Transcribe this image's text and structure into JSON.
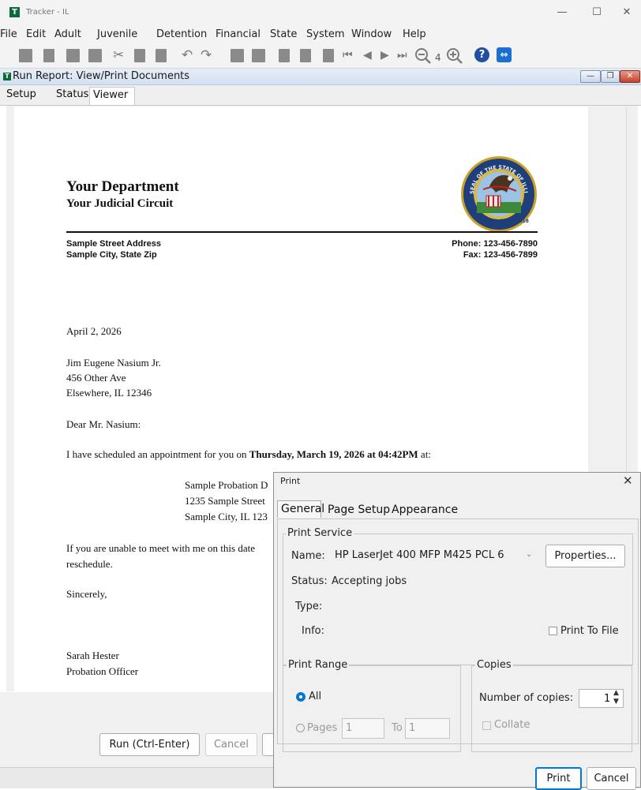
{
  "window": {
    "title": "Tracker - IL",
    "icon_letter": "T",
    "minimize": "—",
    "maximize": "☐",
    "close": "✕"
  },
  "menubar": [
    "File",
    "Edit",
    "Adult",
    "Juvenile",
    "Detention",
    "Financial",
    "State",
    "System",
    "Window",
    "Help"
  ],
  "toolbar": {
    "zoom_level": "4"
  },
  "inner_window": {
    "title": "Run Report: View/Print Documents",
    "icon_letter": "T",
    "minimize": "—",
    "restore": "❐",
    "close": "✕"
  },
  "tabs": [
    "Setup",
    "Status",
    "Viewer"
  ],
  "letter": {
    "dept_name": "Your Department",
    "circuit": "Your Judicial Circuit",
    "address_line1": "Sample Street Address",
    "address_line2": "Sample City, State Zip",
    "phone": "Phone: 123-456-7890",
    "fax": "Fax: 123-456-7899",
    "date": "April 2, 2026",
    "recipient_name": "Jim Eugene Nasium Jr.",
    "recipient_street": "456 Other Ave",
    "recipient_city": "Elsewhere, IL 12346",
    "salutation": "Dear Mr. Nasium:",
    "body_prefix": "I have scheduled an appointment for you on ",
    "body_bold": "Thursday, March 19, 2026 at 04:42PM",
    "body_suffix": " at:",
    "location_line1": "Sample Probation D",
    "location_line2": "1235 Sample Street",
    "location_line3": "Sample City, IL 123",
    "unable_line1": "If you are unable to meet with me on this date",
    "unable_line2": "reschedule.",
    "closing": "Sincerely,",
    "signer_name": "Sarah Hester",
    "signer_title": "Probation Officer",
    "seal_ring_text": "SEAL OF THE STATE OF ILLINOIS",
    "seal_date_text": "AUG. 26TH 1818"
  },
  "buttons": {
    "run": "Run (Ctrl-Enter)",
    "cancel": "Cancel"
  },
  "print_dialog": {
    "title": "Print",
    "close": "✕",
    "tabs": [
      "General",
      "Page Setup",
      "Appearance"
    ],
    "print_service_legend": "Print Service",
    "name_label": "Name:",
    "printer_name": "HP LaserJet 400 MFP M425 PCL 6",
    "properties_button": "Properties...",
    "status_label": "Status:",
    "status_value": "Accepting jobs",
    "type_label": "Type:",
    "info_label": "Info:",
    "print_to_file_label": "Print To File",
    "print_to_file_checked": false,
    "print_range_legend": "Print Range",
    "all_label": "All",
    "pages_label": "Pages",
    "pages_from": "1",
    "pages_to_label": "To",
    "pages_to": "1",
    "selected_range": "All",
    "copies_legend": "Copies",
    "num_copies_label": "Number of copies:",
    "num_copies": "1",
    "collate_label": "Collate",
    "collate_checked": false,
    "print_button": "Print",
    "cancel_button": "Cancel"
  },
  "colors": {
    "app_icon": "#0b6a3a",
    "accent": "#0078d4",
    "title_bar": "#f3f3f3",
    "inner_title_bar": "#d3e0f1",
    "inner_close": "#c4412c"
  },
  "icons": [
    "save-icon",
    "delete-icon",
    "new-record-icon",
    "form-icon",
    "cut-icon",
    "copy-icon",
    "paste-icon",
    "undo-icon",
    "redo-icon",
    "add-row-icon",
    "remove-row-icon",
    "nav-first-icon",
    "nav-prev-icon",
    "nav-next-icon",
    "nav-last-icon",
    "zoom-out-icon",
    "zoom-in-icon",
    "help-icon",
    "remote-support-icon",
    "illinois-seal-icon"
  ]
}
